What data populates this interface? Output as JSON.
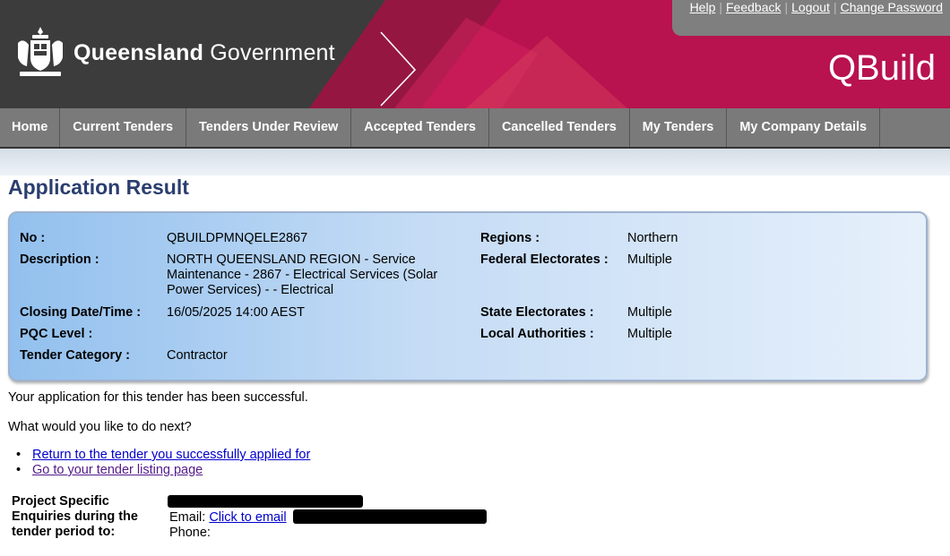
{
  "header": {
    "brand_bold": "Queensland",
    "brand_rest": " Government",
    "app_title": "QBuild",
    "utility_links": [
      "Help",
      "Feedback",
      "Logout",
      "Change Password"
    ],
    "colors": {
      "banner_dark": "#3c3c3c",
      "banner_accent": "#b8124f",
      "utility_bg": "#7f7f7f"
    }
  },
  "nav": {
    "items": [
      "Home",
      "Current Tenders",
      "Tenders Under Review",
      "Accepted Tenders",
      "Cancelled Tenders",
      "My Tenders",
      "My Company Details"
    ]
  },
  "page": {
    "title": "Application Result"
  },
  "tender": {
    "no_label": "No :",
    "no_value": "QBUILDPMNQELE2867",
    "description_label": "Description :",
    "description_value": "NORTH QUEENSLAND REGION - Service Maintenance - 2867 - Electrical Services (Solar Power Services) - - Electrical",
    "closing_label": "Closing Date/Time :",
    "closing_value": "16/05/2025 14:00 AEST",
    "pqc_label": "PQC Level :",
    "pqc_value": "",
    "category_label": "Tender Category :",
    "category_value": "Contractor",
    "regions_label": "Regions :",
    "regions_value": "Northern",
    "federal_label": "Federal Electorates :",
    "federal_value": "Multiple",
    "state_label": "State Electorates :",
    "state_value": "Multiple",
    "local_label": "Local Authorities :",
    "local_value": "Multiple"
  },
  "result": {
    "message": "Your application for this tender has been successful.",
    "next_prompt": "What would you like to do next?",
    "links": [
      "Return to the tender you successfully applied for",
      "Go to your tender listing page"
    ]
  },
  "enquiries": {
    "label": "Project Specific Enquiries during the tender period to:",
    "email_prefix": "Email: ",
    "email_link": "Click to email",
    "phone_prefix": "Phone:"
  }
}
